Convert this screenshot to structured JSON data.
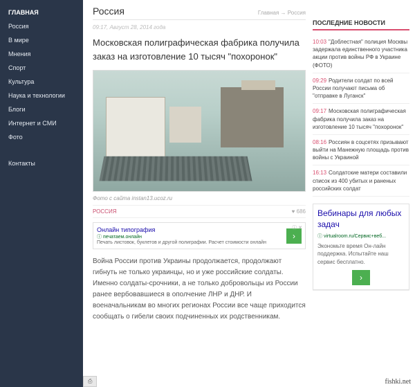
{
  "sidebar": {
    "items": [
      {
        "label": "ГЛАВНАЯ"
      },
      {
        "label": "Россия"
      },
      {
        "label": "В мире"
      },
      {
        "label": "Мнения"
      },
      {
        "label": "Спорт"
      },
      {
        "label": "Культура"
      },
      {
        "label": "Наука и технологии"
      },
      {
        "label": "Блоги"
      },
      {
        "label": "Интернет и СМИ"
      },
      {
        "label": "Фото"
      }
    ],
    "contacts": "Контакты"
  },
  "header": {
    "title": "Россия",
    "breadcrumb": "Главная → Россия"
  },
  "article": {
    "timestamp": "09:17, Август 28, 2014 года",
    "title": "Московская полиграфическая фабрика получила заказ на изготовление 10 тысяч \"похоронок\"",
    "caption": "Фото с сайта instan13.ucoz.ru",
    "category": "РОССИЯ",
    "likes": "♥ 686",
    "body": "Война России против Украины продолжается, продолжают гибнуть не только украинцы, но и уже российские солдаты. Именно солдаты-срочники, а не только добровольцы из России ранее вербовавшиеся в ополчение ЛНР и ДНР. И военачальникам во многих регионах России все чаще приходится сообщать о гибели своих подчиненных их родственникам."
  },
  "ad_inline": {
    "badge": "ⓘ ✕",
    "title": "Онлайн типография",
    "sub": "ⓘ печатаем.онлайн",
    "desc": "Печать листовок, буклетов и другой полиграфии. Расчет стоимости онлайн",
    "arrow": "›"
  },
  "rail": {
    "header": "ПОСЛЕДНИЕ НОВОСТИ",
    "items": [
      {
        "time": "10:03",
        "text": "\"Доблестная\" полиция Москвы задержала единственного участника акции против войны РФ в Украине (ФОТО)"
      },
      {
        "time": "09:29",
        "text": "Родители солдат по всей России получают письма об \"отправке в Луганск\""
      },
      {
        "time": "09:17",
        "text": "Московская полиграфическая фабрика получила заказ на изготовление 10 тысяч \"похоронок\""
      },
      {
        "time": "08:16",
        "text": "Россиян в соцсетях призывают выйти на Манежную площадь против войны с Украиной"
      },
      {
        "time": "16:13",
        "text": "Солдатские матери составили список из 400 убитых и раненых российских солдат"
      }
    ],
    "ad": {
      "title": "Вебинары для любых задач",
      "url": "ⓘ virtualroom.ru/Сервис+веб...",
      "desc": "Экономьте время Он-лайн поддержка. Испытайте наш сервис бесплатно.",
      "arrow": "›"
    },
    "lang": ""
  },
  "footer": {
    "badge_icon": "⎙",
    "brand": "fishki.net"
  }
}
